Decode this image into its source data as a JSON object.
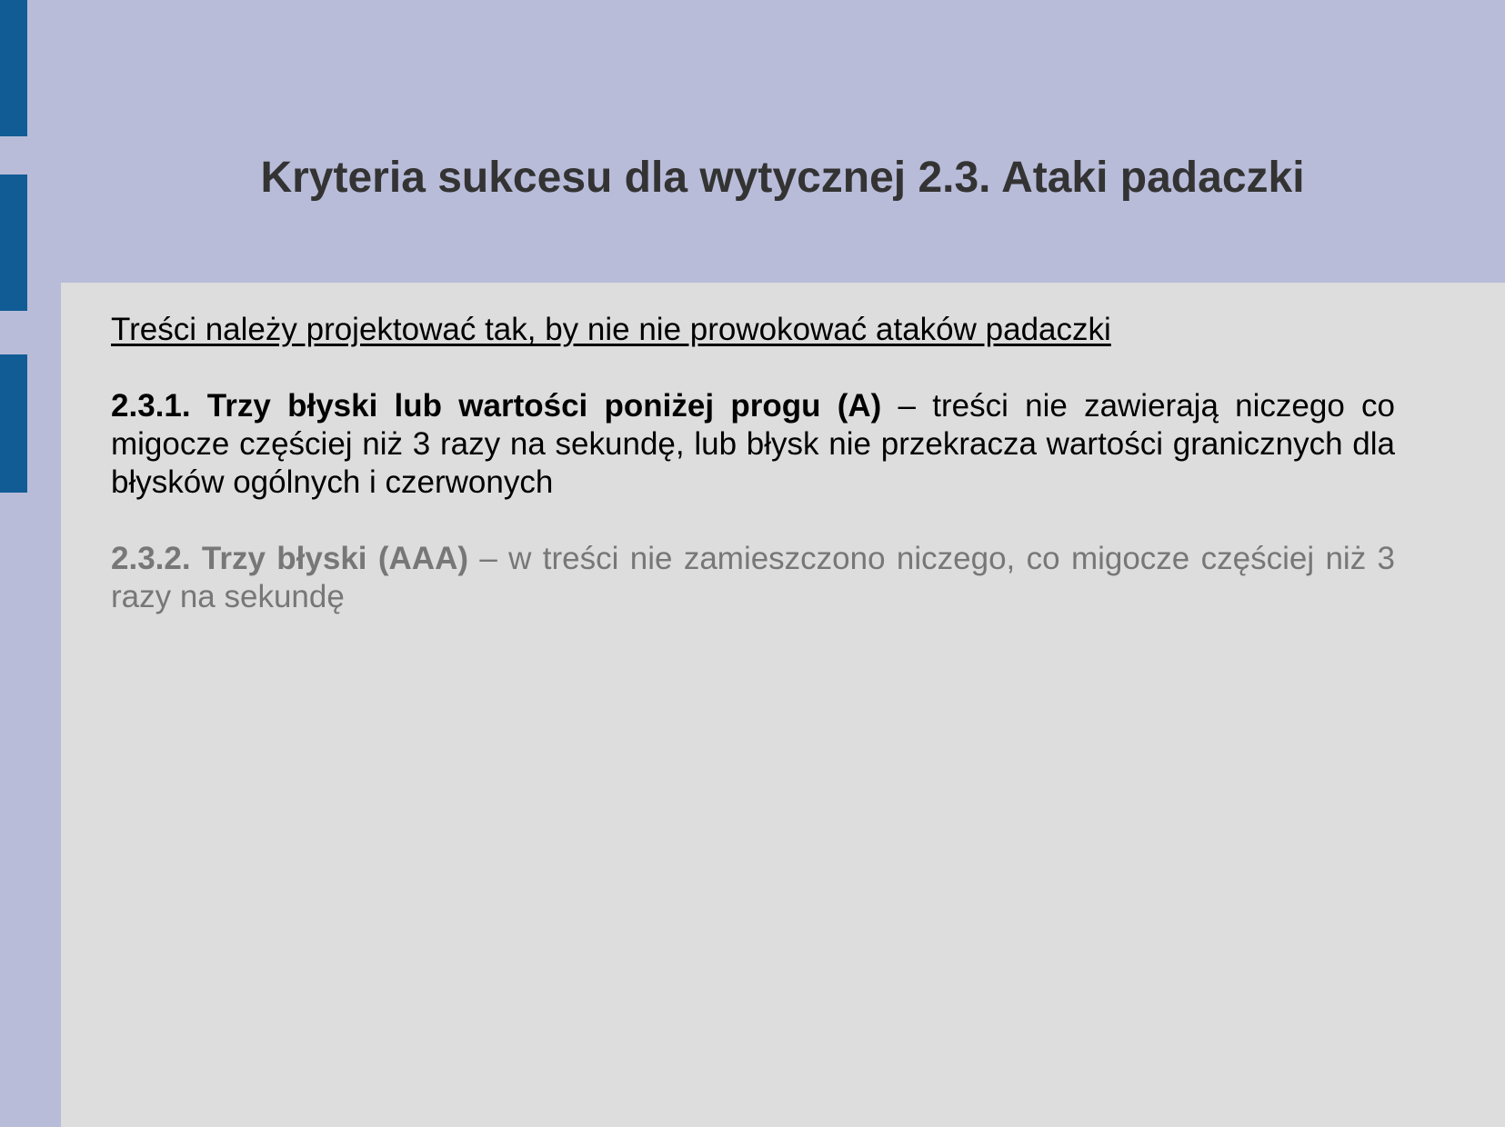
{
  "slide": {
    "title": "Kryteria sukcesu dla wytycznej 2.3. Ataki padaczki",
    "intro": "Treści należy projektować tak, by nie nie prowokować ataków padaczki",
    "criteria": [
      {
        "label": "2.3.1. Trzy błyski lub wartości poniżej progu (A)",
        "text": " – treści nie zawierają niczego co migocze częściej niż 3 razy na sekundę, lub błysk nie przekracza wartości granicznych dla błysków ogólnych i czerwonych"
      },
      {
        "label": "2.3.2. Trzy błyski (AAA)",
        "text": " – w treści nie zamieszczono niczego, co migocze częściej niż 3 razy na sekundę"
      }
    ]
  },
  "colors": {
    "header_background": "#b8bcd9",
    "content_background": "#dddddd",
    "accent": "#115c95",
    "title_text": "#333333",
    "muted_text": "#777777"
  }
}
